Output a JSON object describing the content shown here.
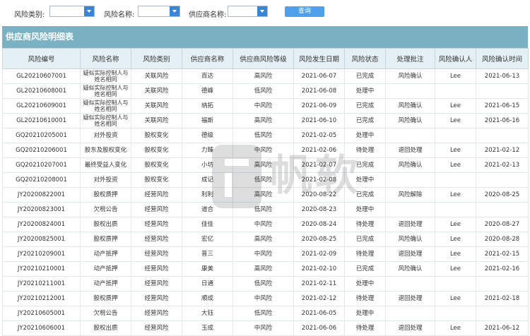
{
  "filters": {
    "risk_type_label": "风险类别:",
    "risk_name_label": "风险名称:",
    "supplier_name_label": "供应商名称:",
    "query_button": "查询"
  },
  "report": {
    "title": "供应商风险明细表",
    "columns": [
      "风险编号",
      "风险名称",
      "风险类别",
      "供应商名称",
      "供应商风险等级",
      "风险发生日期",
      "风险状态",
      "处理批注",
      "风险确认人",
      "风险确认时间"
    ],
    "rows": [
      [
        "GL20210607001",
        "疑似实际控制人与姓名相同",
        "关联风险",
        "百达",
        "高风险",
        "2021-06-07",
        "已完成",
        "风险确认",
        "Lee",
        "2021-06-13"
      ],
      [
        "GL20210608001",
        "疑似实际控制人与姓名相同",
        "关联风险",
        "德峰",
        "低风险",
        "2021-06-08",
        "处理中",
        "",
        "",
        ""
      ],
      [
        "GL20210609001",
        "疑似实际控制人与姓名相同",
        "关联风险",
        "纳拓",
        "中风险",
        "2021-06-09",
        "已完成",
        "风险确认",
        "Lee",
        "2021-06-15"
      ],
      [
        "GL20210610001",
        "疑似实际控制人与姓名相同",
        "关联风险",
        "福斯",
        "高风险",
        "2021-06-10",
        "已完成",
        "风险确认",
        "Lee",
        "2021-06-16"
      ],
      [
        "GQ20210205001",
        "对外投资",
        "股权变化",
        "德级",
        "低风险",
        "2021-02-05",
        "处理中",
        "",
        "",
        ""
      ],
      [
        "GQ20210206001",
        "股东及股权变化",
        "股权变化",
        "力臻",
        "中风险",
        "2021-02-06",
        "待处理",
        "退回处理",
        "Lee",
        "2021-02-12"
      ],
      [
        "GQ20210207001",
        "最终受益人变化",
        "股权变化",
        "小坊",
        "高风险",
        "2021-02-07",
        "已完成",
        "风险确认",
        "Lee",
        "2021-02-13"
      ],
      [
        "GQ20210208001",
        "对外投资",
        "股权变化",
        "成记",
        "低风险",
        "2021-02-08",
        "处理中",
        "",
        "",
        ""
      ],
      [
        "JY20200822001",
        "股权质押",
        "经营风险",
        "利利",
        "高风险",
        "2020-08-22",
        "已完成",
        "风险解除",
        "Lee",
        "2020-08-25"
      ],
      [
        "JY20200823001",
        "欠税公告",
        "经营风险",
        "道合",
        "低风险",
        "2020-08-23",
        "处理中",
        "",
        "",
        ""
      ],
      [
        "JY20200824001",
        "股权出质",
        "经营风险",
        "佳佳",
        "中风险",
        "2020-08-24",
        "待处理",
        "退回处理",
        "Lee",
        "2020-08-27"
      ],
      [
        "JY20200825001",
        "股权质押",
        "经营风险",
        "宏亿",
        "高风险",
        "2020-08-25",
        "已完成",
        "风险确认",
        "Lee",
        "2020-08-28"
      ],
      [
        "JY20210209001",
        "动产抵押",
        "经营风险",
        "普三",
        "中风险",
        "2021-02-09",
        "待处理",
        "退回处理",
        "Lee",
        "2021-02-15"
      ],
      [
        "JY20210210001",
        "动产抵押",
        "经营风险",
        "康美",
        "高风险",
        "2021-02-10",
        "已完成",
        "风险确认",
        "Lee",
        "2021-02-16"
      ],
      [
        "JY20210211001",
        "动产抵押",
        "经营风险",
        "日通",
        "低风险",
        "2021-02-11",
        "处理中",
        "",
        "",
        ""
      ],
      [
        "JY20210212001",
        "股权质押",
        "经营风险",
        "顺成",
        "中风险",
        "2021-02-12",
        "待处理",
        "退回处理",
        "Lee",
        "2021-02-18"
      ],
      [
        "JY20210605001",
        "欠税公告",
        "经营风险",
        "大钰",
        "低风险",
        "2021-06-05",
        "处理中",
        "",
        "",
        ""
      ],
      [
        "JY20210606001",
        "股权出质",
        "经营风险",
        "玉成",
        "中风险",
        "2021-06-06",
        "待处理",
        "退回处理",
        "Lee",
        "2021-06-12"
      ]
    ]
  },
  "watermark": {
    "text": "帆软"
  },
  "icons": {
    "dropdown": "chevron-down-icon",
    "watermark_logo": "finereport-logo"
  },
  "colors": {
    "header_bar": "#7ab2c4",
    "column_header": "#e4f0f4",
    "query_button": "#4fa0ea",
    "dropdown_arrow": "#3a86d6"
  }
}
